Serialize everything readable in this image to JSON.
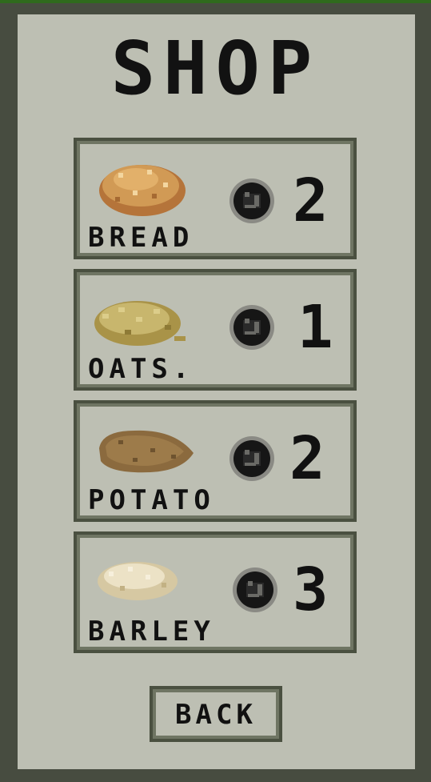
{
  "title": "SHOP",
  "items": [
    {
      "name": "BREAD",
      "price": "2",
      "icon": "bread-icon",
      "color": "#c08a48"
    },
    {
      "name": "OATS.",
      "price": "1",
      "icon": "oats-icon",
      "color": "#b9a55a"
    },
    {
      "name": "POTATO",
      "price": "2",
      "icon": "potato-icon",
      "color": "#8b6a3e"
    },
    {
      "name": "BARLEY",
      "price": "3",
      "icon": "barley-icon",
      "color": "#e3d7b8"
    }
  ],
  "currency_icon": "coin-icon",
  "back_label": "BACK",
  "colors": {
    "background": "#474c40",
    "panel": "#bdbfb3",
    "border": "#4a5040",
    "text": "#111111"
  }
}
